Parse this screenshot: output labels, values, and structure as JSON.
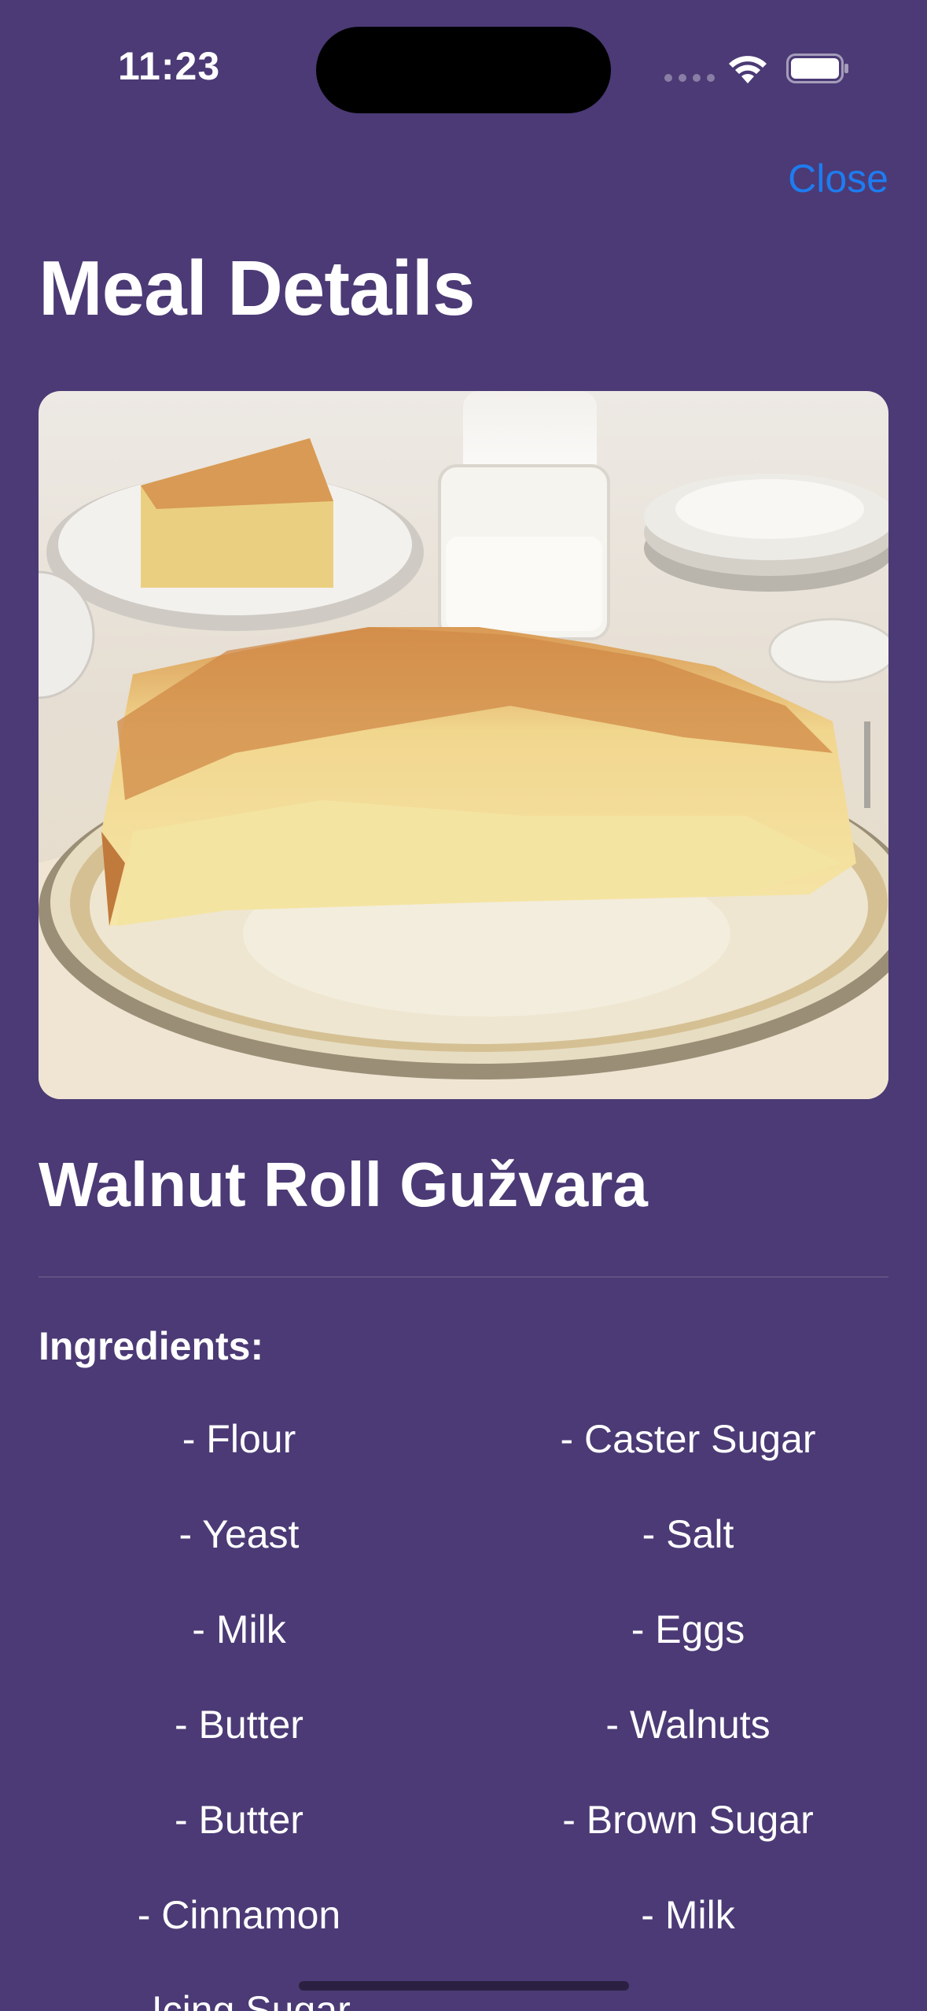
{
  "status_bar": {
    "time": "11:23"
  },
  "header": {
    "close_label": "Close",
    "title": "Meal Details"
  },
  "meal": {
    "name": "Walnut Roll Gužvara",
    "ingredients_label": "Ingredients:",
    "ingredients": [
      "- Flour",
      "- Caster Sugar",
      "- Yeast",
      "- Salt",
      "- Milk",
      "- Eggs",
      "- Butter",
      "- Walnuts",
      "- Butter",
      "- Brown Sugar",
      "- Cinnamon",
      "- Milk",
      "- Icing Sugar"
    ]
  },
  "colors": {
    "background": "#4B3A75",
    "accent": "#1E7CF0",
    "text": "#FFFFFF"
  },
  "icons": [
    "wifi-icon",
    "battery-icon",
    "signal-dots"
  ]
}
